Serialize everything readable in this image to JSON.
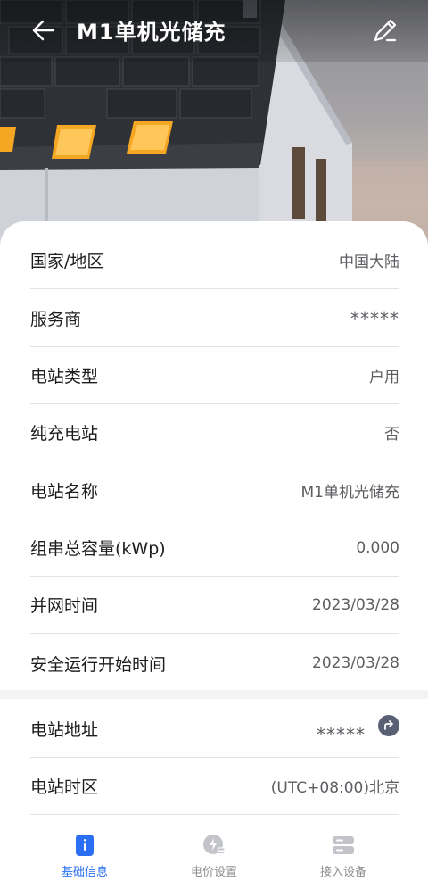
{
  "header": {
    "title": "M1单机光储充"
  },
  "details": [
    {
      "label": "国家/地区",
      "value": "中国大陆"
    },
    {
      "label": "服务商",
      "value": "*****"
    },
    {
      "label": "电站类型",
      "value": "户用"
    },
    {
      "label": "纯充电站",
      "value": "否"
    },
    {
      "label": "电站名称",
      "value": "M1单机光储充"
    },
    {
      "label": "组串总容量(kWp)",
      "value": "0.000"
    },
    {
      "label": "并网时间",
      "value": "2023/03/28"
    },
    {
      "label": "安全运行开始时间",
      "value": "2023/03/28"
    }
  ],
  "location": [
    {
      "label": "电站地址",
      "value": "*****"
    },
    {
      "label": "电站时区",
      "value": "(UTC+08:00)北京"
    }
  ],
  "tabs": [
    {
      "label": "基础信息",
      "icon": "info-icon",
      "active": true
    },
    {
      "label": "电价设置",
      "icon": "price-icon",
      "active": false
    },
    {
      "label": "接入设备",
      "icon": "device-icon",
      "active": false
    }
  ],
  "colors": {
    "accent": "#2a6ff3",
    "text": "#1d1d1f",
    "muted": "#5d5d62"
  }
}
